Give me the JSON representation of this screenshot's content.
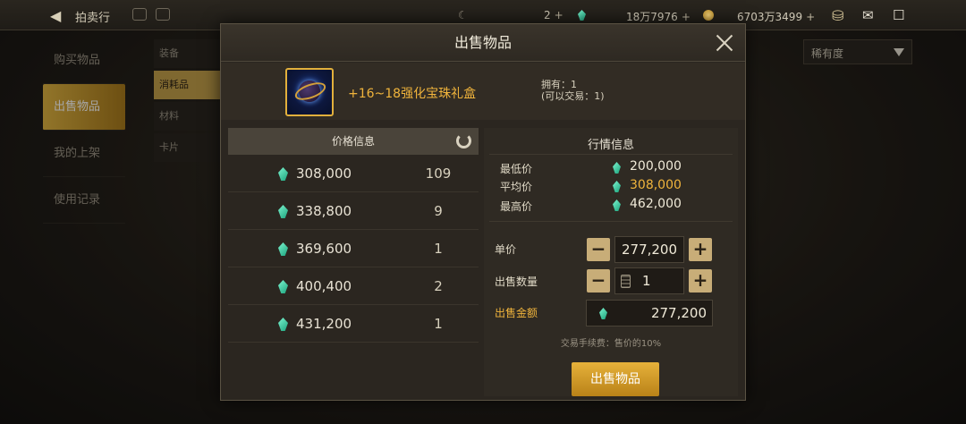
{
  "topbar": {
    "title": "拍卖行",
    "resources": [
      {
        "value": "2",
        "icon": "moon-icon"
      },
      {
        "value": "18万7976",
        "icon": "gem-icon"
      },
      {
        "value": "6703万3499",
        "icon": "coin-icon"
      }
    ]
  },
  "sidenav": [
    "购买物品",
    "出售物品",
    "我的上架",
    "使用记录"
  ],
  "subnav": [
    "装备",
    "消耗品",
    "材料",
    "卡片"
  ],
  "sort": {
    "label": "稀有度"
  },
  "modal": {
    "title": "出售物品",
    "item": {
      "name": "+16~18强化宝珠礼盒",
      "owned": "拥有：1",
      "tradable": "(可以交易：1)"
    },
    "price_info": {
      "title": "价格信息",
      "rows": [
        {
          "price": "308,000",
          "qty": "109"
        },
        {
          "price": "338,800",
          "qty": "9"
        },
        {
          "price": "369,600",
          "qty": "1"
        },
        {
          "price": "400,400",
          "qty": "2"
        },
        {
          "price": "431,200",
          "qty": "1"
        }
      ]
    },
    "market": {
      "title": "行情信息",
      "min_label": "最低价",
      "min": "200,000",
      "avg_label": "平均价",
      "avg": "308,000",
      "max_label": "最高价",
      "max": "462,000"
    },
    "form": {
      "unit_label": "单价",
      "unit_price": "277,200",
      "qty_label": "出售数量",
      "qty": "1",
      "total_label": "出售金额",
      "total": "277,200",
      "fee_note": "交易手续费：售价的10%",
      "sell_button": "出售物品"
    }
  },
  "colors": {
    "accent": "#e0b441",
    "price_highlight": "#f0b43c",
    "gem": "#3fd0a4"
  }
}
